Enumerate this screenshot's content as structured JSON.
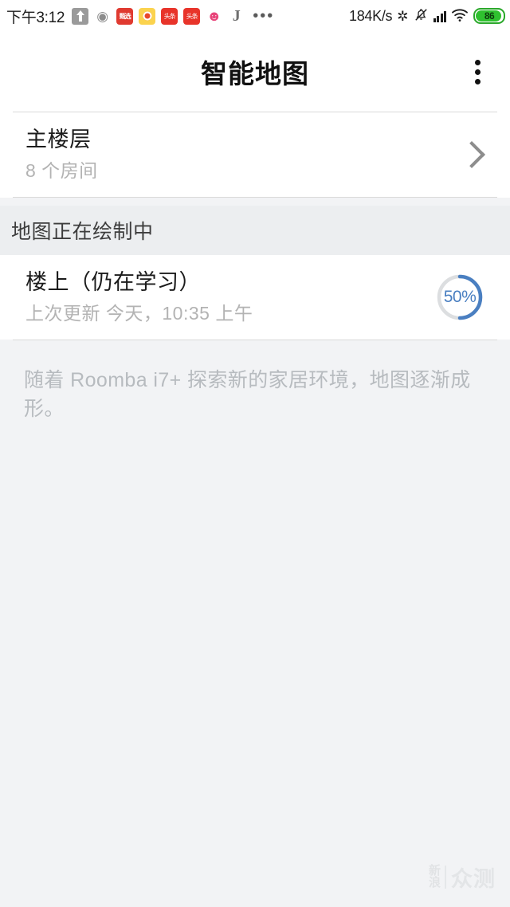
{
  "statusbar": {
    "time": "下午3:12",
    "icons": [
      {
        "name": "upload-icon",
        "label": ""
      },
      {
        "name": "weibo-icon",
        "label": "◉"
      },
      {
        "name": "app-red-icon",
        "label": "甄选"
      },
      {
        "name": "app-yellow-eye-icon",
        "label": ""
      },
      {
        "name": "toutiao-icon-1",
        "label": "头条"
      },
      {
        "name": "toutiao-icon-2",
        "label": "头条"
      },
      {
        "name": "app-pink-icon",
        "label": "☻"
      },
      {
        "name": "jd-icon",
        "label": "J"
      },
      {
        "name": "more-icons",
        "label": "•••"
      }
    ],
    "network_speed": "184K/s",
    "bluetooth": "✲",
    "silent": "⃠",
    "signal": "signal-bars-icon",
    "wifi": "wifi-icon",
    "battery_level": "86"
  },
  "appbar": {
    "title": "智能地图",
    "overflow_menu": "more-options"
  },
  "floors": [
    {
      "name": "主楼层",
      "subtitle": "8 个房间",
      "accessory": "chevron-right"
    }
  ],
  "section": {
    "header": "地图正在绘制中",
    "items": [
      {
        "name": "楼上（仍在学习）",
        "subtitle": "上次更新 今天，10:35 上午",
        "progress_label": "50%",
        "progress_value": 50
      }
    ]
  },
  "footnote": "随着 Roomba i7+ 探索新的家居环境，地图逐渐成形。",
  "watermark": {
    "line1": "新",
    "line2": "浪",
    "text": "众测"
  },
  "colors": {
    "accent": "#4a7fc1",
    "track": "#dcdee0",
    "battery": "#2fc12f",
    "divider": "#d9d9d9",
    "section_bg": "#eceef0",
    "page_bg": "#f2f3f5"
  }
}
